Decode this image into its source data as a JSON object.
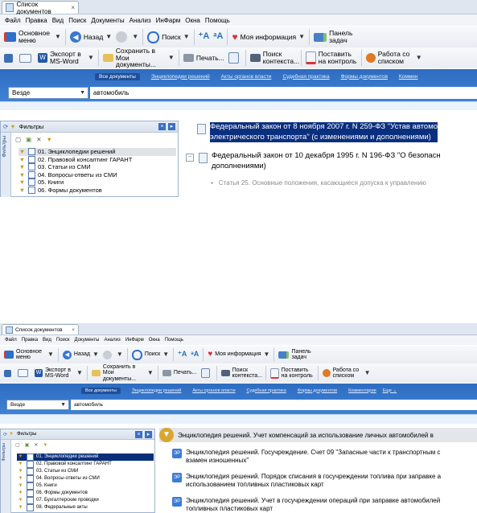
{
  "window": {
    "tab_title": "Список документов"
  },
  "menu": [
    "Файл",
    "Правка",
    "Вид",
    "Поиск",
    "Документы",
    "Анализ",
    "ИнФарм",
    "Окна",
    "Помощь"
  ],
  "toolbar1": {
    "main_menu": "Основное меню",
    "back": "Назад",
    "search": "Поиск",
    "my_info": "Моя информация",
    "task_panel": "Панель задач"
  },
  "toolbar2": {
    "export_word": "Экспорт в MS-Word",
    "save_to_docs": "Сохранить в Мои документы...",
    "print": "Печать...",
    "context_search": "Поиск контекста...",
    "set_control": "Поставить на контроль",
    "work_list": "Работа со списком"
  },
  "band_links_top": [
    "Все документы",
    "Энциклопедии решений",
    "Акты органов власти",
    "Судебная практика",
    "Формы документов",
    "Коммен"
  ],
  "band_links_bottom": [
    "Все документы",
    "Энциклопедии решений",
    "Акты органов власти",
    "Судебная практика",
    "Формы документов",
    "Комментарии",
    "Еще"
  ],
  "search": {
    "scope": "Везде",
    "query": "автомобиль"
  },
  "filters": {
    "title": "Фильтры",
    "vertical_tab": "Фильтры",
    "items_top": [
      "01. Энциклопедии решений",
      "02. Правовой консалтинг ГАРАНТ",
      "03. Статьи из СМИ",
      "04. Вопросы-ответы из СМИ",
      "05. Книги",
      "06. Формы документов"
    ],
    "items_bottom": [
      "01. Энциклопедии решений",
      "02. Правовой консалтинг ГАРАНТ",
      "03. Статьи из СМИ",
      "04. Вопросы-ответы из СМИ",
      "05. Книги",
      "06. Формы документов",
      "07. Бухгалтерские проводки",
      "08. Федеральные акты"
    ]
  },
  "results_top": {
    "r1_line1": "Федеральный закон от 8 ноября 2007 г. N 259-ФЗ \"Устав автомо",
    "r1_line2": "электрического транспорта\" (с изменениями и дополнениями)",
    "r2_line1": "Федеральный закон от 10 декабря 1995 г. N 196-ФЗ \"О безопасн",
    "r2_line2": "дополнениями)",
    "r2_sub": "Статья 25. Основные положения, касающиеся допуска к управлению"
  },
  "results_bottom": {
    "r1": "Энциклопедия решений. Учет компенсаций за использование личных автомобилей в",
    "r2_line1": "Энциклопедия решений. Госучреждение. Счет 09 \"Запасные части к транспортным с",
    "r2_line2": "взамен изношенных\"",
    "r3_line1": "Энциклопедия решений. Порядок списания в госучреждении топлива при заправке а",
    "r3_line2": "использованием топливных пластиковых карт",
    "r4_line1": "Энциклопедия решений. Учет в госучреждении операций при заправке автомобилей",
    "r4_line2": "топливных пластиковых карт"
  }
}
